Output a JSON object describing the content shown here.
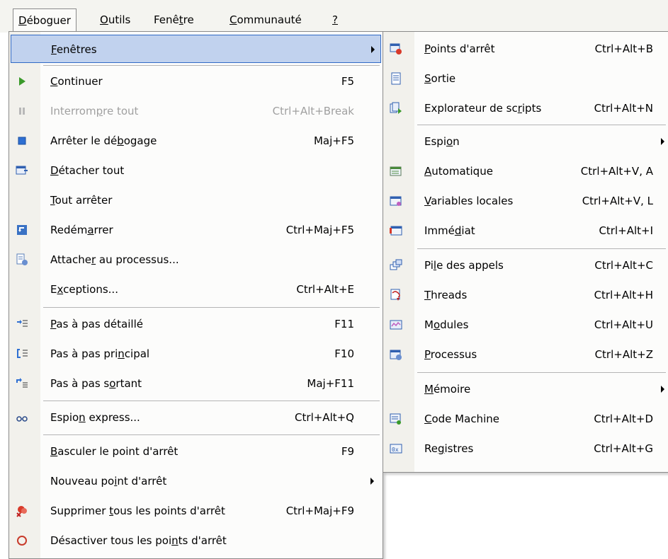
{
  "menubar": {
    "items": [
      {
        "pre": "",
        "u": "D",
        "post": "éboguer"
      },
      {
        "pre": "",
        "u": "O",
        "post": "utils"
      },
      {
        "pre": "Fenê",
        "u": "t",
        "post": "re"
      },
      {
        "pre": "",
        "u": "C",
        "post": "ommunauté"
      },
      {
        "pre": "",
        "u": "?",
        "post": ""
      }
    ]
  },
  "debug_menu": {
    "items": [
      {
        "pre": "",
        "u": "F",
        "post": "enêtres",
        "shortcut": ""
      },
      {
        "pre": "",
        "u": "C",
        "post": "ontinuer",
        "shortcut": "F5"
      },
      {
        "pre": "Interrom",
        "u": "p",
        "post": "re tout",
        "shortcut": "Ctrl+Alt+Break"
      },
      {
        "pre": "Arrêter le dé",
        "u": "b",
        "post": "ogage",
        "shortcut": "Maj+F5"
      },
      {
        "pre": "",
        "u": "D",
        "post": "étacher tout",
        "shortcut": ""
      },
      {
        "pre": "",
        "u": "T",
        "post": "out arrêter",
        "shortcut": ""
      },
      {
        "pre": "Redém",
        "u": "a",
        "post": "rrer",
        "shortcut": "Ctrl+Maj+F5"
      },
      {
        "pre": "Attache",
        "u": "r",
        "post": " au processus...",
        "shortcut": ""
      },
      {
        "pre": "E",
        "u": "x",
        "post": "ceptions...",
        "shortcut": "Ctrl+Alt+E"
      },
      {
        "pre": "",
        "u": "P",
        "post": "as à pas détaillé",
        "shortcut": "F11"
      },
      {
        "pre": "Pas à pas pri",
        "u": "n",
        "post": "cipal",
        "shortcut": "F10"
      },
      {
        "pre": "Pas à pas s",
        "u": "o",
        "post": "rtant",
        "shortcut": "Maj+F11"
      },
      {
        "pre": "Espio",
        "u": "n",
        "post": " express...",
        "shortcut": "Ctrl+Alt+Q"
      },
      {
        "pre": "",
        "u": "B",
        "post": "asculer le point d'arrêt",
        "shortcut": "F9"
      },
      {
        "pre": "Nouveau po",
        "u": "i",
        "post": "nt d'arrêt",
        "shortcut": ""
      },
      {
        "pre": "Supprimer ",
        "u": "t",
        "post": "ous les points d'arrêt",
        "shortcut": "Ctrl+Maj+F9"
      },
      {
        "pre": "Désactiver tous les poi",
        "u": "n",
        "post": "ts d'arrêt",
        "shortcut": ""
      }
    ]
  },
  "windows_submenu": {
    "items": [
      {
        "pre": "",
        "u": "P",
        "post": "oints d'arrêt",
        "shortcut": "Ctrl+Alt+B"
      },
      {
        "pre": "",
        "u": "S",
        "post": "ortie",
        "shortcut": ""
      },
      {
        "pre": "Explorateur de sc",
        "u": "r",
        "post": "ipts",
        "shortcut": "Ctrl+Alt+N"
      },
      {
        "pre": "Espi",
        "u": "o",
        "post": "n",
        "shortcut": ""
      },
      {
        "pre": "",
        "u": "A",
        "post": "utomatique",
        "shortcut": "Ctrl+Alt+V, A"
      },
      {
        "pre": "",
        "u": "V",
        "post": "ariables locales",
        "shortcut": "Ctrl+Alt+V, L"
      },
      {
        "pre": "Immé",
        "u": "d",
        "post": "iat",
        "shortcut": "Ctrl+Alt+I"
      },
      {
        "pre": "Pi",
        "u": "l",
        "post": "e des appels",
        "shortcut": "Ctrl+Alt+C"
      },
      {
        "pre": "",
        "u": "T",
        "post": "hreads",
        "shortcut": "Ctrl+Alt+H"
      },
      {
        "pre": "M",
        "u": "o",
        "post": "dules",
        "shortcut": "Ctrl+Alt+U"
      },
      {
        "pre": "",
        "u": "P",
        "post": "rocessus",
        "shortcut": "Ctrl+Alt+Z"
      },
      {
        "pre": "",
        "u": "M",
        "post": "émoire",
        "shortcut": ""
      },
      {
        "pre": "",
        "u": "C",
        "post": "ode Machine",
        "shortcut": "Ctrl+Alt+D"
      },
      {
        "pre": "Re",
        "u": "g",
        "post": "istres",
        "shortcut": "Ctrl+Alt+G"
      }
    ]
  },
  "colors": {
    "highlight_bg": "#c1d2ee",
    "highlight_border": "#316ac5",
    "gutter": "#f2f1ec",
    "disabled_text": "#a0a0a0"
  }
}
